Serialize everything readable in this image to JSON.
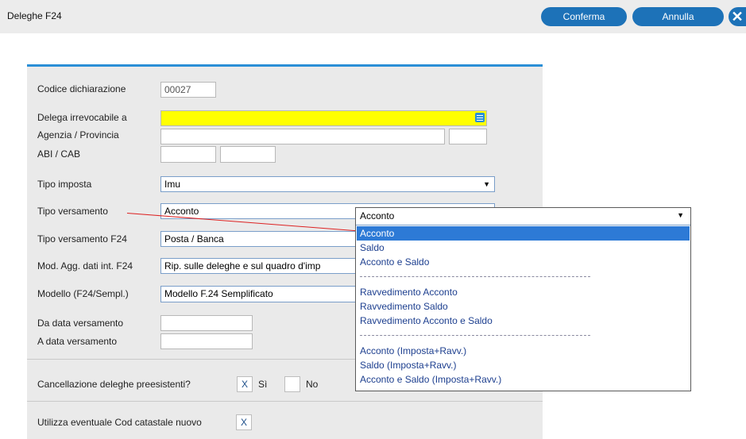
{
  "header": {
    "title": "Deleghe F24",
    "confirm_label": "Conferma",
    "cancel_label": "Annulla",
    "close_glyph": "✕"
  },
  "form": {
    "codice_dichiarazione": {
      "label": "Codice dichiarazione",
      "value": "00027"
    },
    "delega_irrevocabile": {
      "label": "Delega irrevocabile a",
      "value": ""
    },
    "agenzia_provincia": {
      "label": "Agenzia / Provincia",
      "value": "",
      "value2": ""
    },
    "abi_cab": {
      "label": "ABI / CAB",
      "abi": "",
      "cab": ""
    },
    "tipo_imposta": {
      "label": "Tipo imposta",
      "value": "Imu"
    },
    "tipo_versamento": {
      "label": "Tipo versamento",
      "value": "Acconto"
    },
    "tipo_versamento_f24": {
      "label": "Tipo versamento F24",
      "value": "Posta / Banca"
    },
    "mod_agg": {
      "label": "Mod. Agg. dati int. F24",
      "value": "Rip. sulle deleghe e sul quadro d'imp"
    },
    "modello": {
      "label": "Modello (F24/Sempl.)",
      "value": "Modello F.24 Semplificato"
    },
    "da_data": {
      "label": "Da data versamento",
      "value": ""
    },
    "a_data": {
      "label": "A data versamento",
      "value": ""
    },
    "cancellazione": {
      "label": "Cancellazione deleghe preesistenti?",
      "si_check": "X",
      "si_label": "Sì",
      "no_check": "",
      "no_label": "No"
    },
    "cod_catastale": {
      "label": "Utilizza eventuale Cod catastale nuovo",
      "check": "X"
    }
  },
  "dropdown": {
    "current": "Acconto",
    "options": [
      "Acconto",
      "Saldo",
      "Acconto e Saldo",
      "Ravvedimento Acconto",
      "Ravvedimento Saldo",
      "Ravvedimento Acconto e Saldo",
      "Acconto (Imposta+Ravv.)",
      "Saldo (Imposta+Ravv.)",
      "Acconto e Saldo (Imposta+Ravv.)"
    ],
    "selected_index": 0
  },
  "icons": {
    "arrow": "▼",
    "list_icon": "list-icon",
    "close_icon": "close-icon"
  },
  "colors": {
    "accent": "#1d72b8",
    "highlight_yellow": "#ffff00",
    "selected_option": "#2d7ad6"
  }
}
